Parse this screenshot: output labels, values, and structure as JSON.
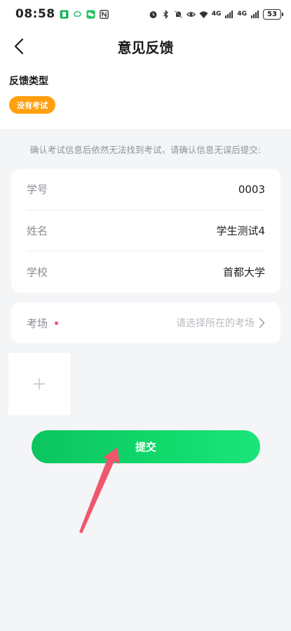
{
  "status_bar": {
    "time": "08:58",
    "net_1": "4G",
    "net_2": "4G",
    "battery": "53"
  },
  "nav": {
    "title": "意见反馈"
  },
  "feedback_type": {
    "label": "反馈类型",
    "selected_chip": "没有考试"
  },
  "hint": "确认考试信息后依然无法找到考试，请确认信息无误后提交:",
  "info": {
    "rows": [
      {
        "key": "学号",
        "value": "0003"
      },
      {
        "key": "姓名",
        "value": "学生测试4"
      },
      {
        "key": "学校",
        "value": "首都大学"
      }
    ]
  },
  "exam_room": {
    "key": "考场",
    "placeholder": "请选择所在的考场"
  },
  "submit": {
    "label": "提交"
  },
  "colors": {
    "accent_green": "#10d86a",
    "chip_orange": "#ff9f0f",
    "required_dot": "#f0566d",
    "annotation_arrow": "#f0566d"
  }
}
